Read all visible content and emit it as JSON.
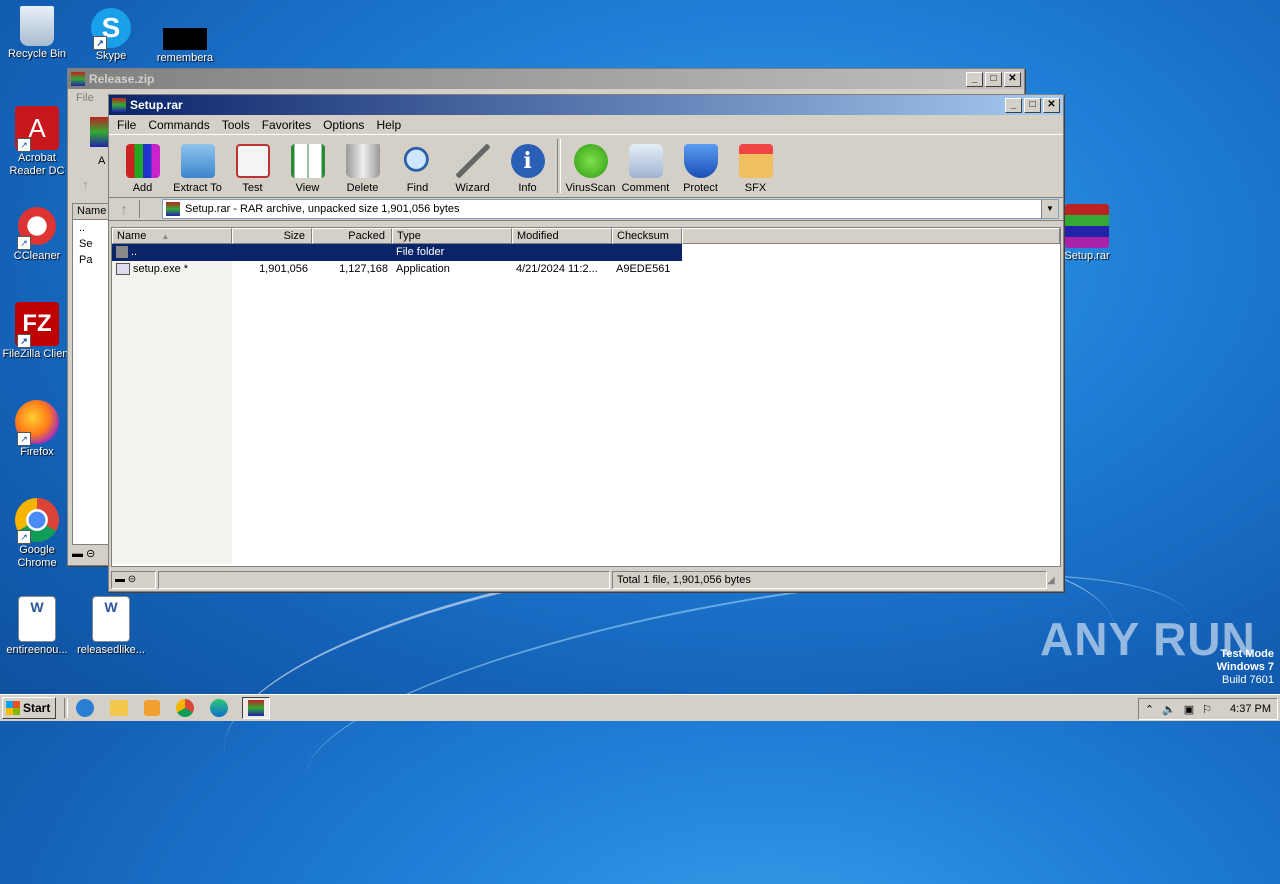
{
  "desktop": {
    "icons": [
      {
        "label": "Recycle Bin",
        "icon": "recycle-bin-icon"
      },
      {
        "label": "Skype",
        "icon": "skype-icon"
      },
      {
        "label": "remembera",
        "icon": "black-file-icon"
      },
      {
        "label": "Acrobat Reader DC",
        "icon": "acrobat-icon"
      },
      {
        "label": "CCleaner",
        "icon": "ccleaner-icon"
      },
      {
        "label": "FileZilla Client",
        "icon": "filezilla-icon"
      },
      {
        "label": "Firefox",
        "icon": "firefox-icon"
      },
      {
        "label": "Google Chrome",
        "icon": "chrome-icon"
      },
      {
        "label": "entireenou...",
        "icon": "word-doc-icon"
      },
      {
        "label": "releasedlike...",
        "icon": "word-doc-icon"
      },
      {
        "label": "Setup.rar",
        "icon": "winrar-archive-icon"
      }
    ],
    "watermark": "ANY RUN",
    "test_mode": [
      "Test Mode",
      "Windows 7",
      "Build 7601"
    ]
  },
  "back_window": {
    "title": "Release.zip",
    "menu_first": "File",
    "partial_toolbar_label": "A",
    "col_name": "Name",
    "rows": [
      "..",
      "Se",
      "Pa"
    ]
  },
  "window": {
    "title": "Setup.rar",
    "menu": [
      "File",
      "Commands",
      "Tools",
      "Favorites",
      "Options",
      "Help"
    ],
    "toolbar": [
      {
        "label": "Add",
        "icon": "add-books-icon"
      },
      {
        "label": "Extract To",
        "icon": "extract-folder-icon"
      },
      {
        "label": "Test",
        "icon": "test-clipboard-icon"
      },
      {
        "label": "View",
        "icon": "view-book-icon"
      },
      {
        "label": "Delete",
        "icon": "trash-icon"
      },
      {
        "label": "Find",
        "icon": "magnifier-icon"
      },
      {
        "label": "Wizard",
        "icon": "wand-icon"
      },
      {
        "label": "Info",
        "icon": "info-icon"
      },
      {
        "label": "VirusScan",
        "icon": "virus-icon"
      },
      {
        "label": "Comment",
        "icon": "comment-icon"
      },
      {
        "label": "Protect",
        "icon": "shield-icon"
      },
      {
        "label": "SFX",
        "icon": "sfx-box-icon"
      }
    ],
    "address": "Setup.rar - RAR archive, unpacked size 1,901,056 bytes",
    "columns": [
      "Name",
      "Size",
      "Packed",
      "Type",
      "Modified",
      "Checksum"
    ],
    "rows": [
      {
        "name": "..",
        "size": "",
        "packed": "",
        "type": "File folder",
        "modified": "",
        "checksum": ""
      },
      {
        "name": "setup.exe *",
        "size": "1,901,056",
        "packed": "1,127,168",
        "type": "Application",
        "modified": "4/21/2024 11:2...",
        "checksum": "A9EDE561"
      }
    ],
    "status": "Total 1 file, 1,901,056 bytes"
  },
  "taskbar": {
    "start": "Start",
    "clock": "4:37 PM"
  }
}
